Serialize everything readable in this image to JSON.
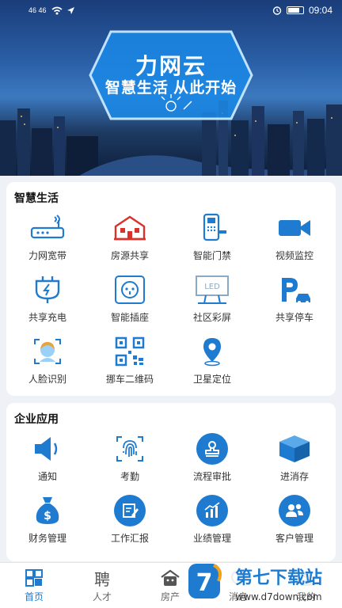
{
  "status_bar": {
    "network": "46 46",
    "time": "09:04"
  },
  "banner": {
    "title": "力网云",
    "subtitle": "智慧生活 从此开始"
  },
  "smart_life": {
    "title": "智慧生活",
    "items": [
      {
        "label": "力网宽带",
        "icon": "router-icon"
      },
      {
        "label": "房源共享",
        "icon": "house-icon"
      },
      {
        "label": "智能门禁",
        "icon": "door-lock-icon"
      },
      {
        "label": "视频监控",
        "icon": "video-camera-icon"
      },
      {
        "label": "共享充电",
        "icon": "charging-plug-icon"
      },
      {
        "label": "智能插座",
        "icon": "socket-icon"
      },
      {
        "label": "社区彩屏",
        "icon": "led-screen-icon"
      },
      {
        "label": "共享停车",
        "icon": "parking-icon"
      },
      {
        "label": "人脸识别",
        "icon": "face-scan-icon"
      },
      {
        "label": "挪车二维码",
        "icon": "qr-code-icon"
      },
      {
        "label": "卫星定位",
        "icon": "location-pin-icon"
      }
    ]
  },
  "enterprise": {
    "title": "企业应用",
    "items": [
      {
        "label": "通知",
        "icon": "speaker-icon"
      },
      {
        "label": "考勤",
        "icon": "fingerprint-icon"
      },
      {
        "label": "流程审批",
        "icon": "stamp-icon"
      },
      {
        "label": "进消存",
        "icon": "box-icon"
      },
      {
        "label": "财务管理",
        "icon": "money-bag-icon"
      },
      {
        "label": "工作汇报",
        "icon": "report-edit-icon"
      },
      {
        "label": "业绩管理",
        "icon": "bar-chart-icon"
      },
      {
        "label": "客户管理",
        "icon": "customers-icon"
      }
    ]
  },
  "bottom_nav": {
    "items": [
      {
        "label": "首页",
        "active": true
      },
      {
        "label": "人才",
        "glyph": "聘"
      },
      {
        "label": "房产"
      },
      {
        "label": "消息"
      },
      {
        "label": "我的"
      }
    ]
  },
  "watermark": {
    "text": "第七下载站",
    "url": "www.d7down.com"
  },
  "colors": {
    "accent": "#1e7bd0",
    "red": "#d9322b"
  }
}
